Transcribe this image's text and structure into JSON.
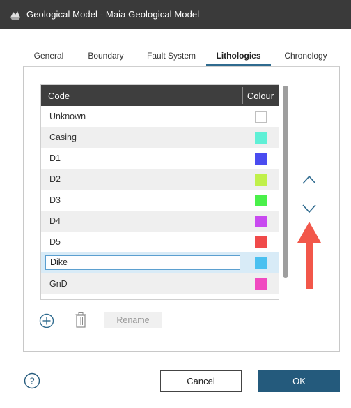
{
  "window": {
    "title": "Geological Model - Maia Geological Model"
  },
  "tabs": [
    {
      "label": "General",
      "active": false
    },
    {
      "label": "Boundary",
      "active": false
    },
    {
      "label": "Fault System",
      "active": false
    },
    {
      "label": "Lithologies",
      "active": true
    },
    {
      "label": "Chronology",
      "active": false
    }
  ],
  "table": {
    "headers": {
      "code": "Code",
      "colour": "Colour"
    },
    "rows": [
      {
        "code": "Unknown",
        "colour": "#ffffff"
      },
      {
        "code": "Casing",
        "colour": "#5ff0d6"
      },
      {
        "code": "D1",
        "colour": "#4a4cf0"
      },
      {
        "code": "D2",
        "colour": "#c0f04a"
      },
      {
        "code": "D3",
        "colour": "#4af04a"
      },
      {
        "code": "D4",
        "colour": "#c84af0"
      },
      {
        "code": "D5",
        "colour": "#f04a4a"
      },
      {
        "code": "Dike",
        "colour": "#4ac0f0",
        "selected": true,
        "editing": true
      },
      {
        "code": "GnD",
        "colour": "#f04ac0"
      },
      {
        "code": "",
        "colour": "#f0c070",
        "partial": true
      }
    ]
  },
  "actions": {
    "rename_label": "Rename"
  },
  "footer": {
    "cancel_label": "Cancel",
    "ok_label": "OK"
  },
  "icons": {
    "app": "geological-model-icon",
    "move_up": "chevron-up-icon",
    "move_down": "chevron-down-icon",
    "add": "plus-circle-icon",
    "delete": "trash-icon",
    "help": "help-circle-icon",
    "annotation": "red-arrow-up-icon"
  },
  "colors": {
    "titlebar": "#3a3a3a",
    "accent": "#245a7c",
    "active_tab_underline": "#2f6b8f",
    "annotation_arrow": "#f2574a",
    "selected_row": "#d8ebf7"
  }
}
